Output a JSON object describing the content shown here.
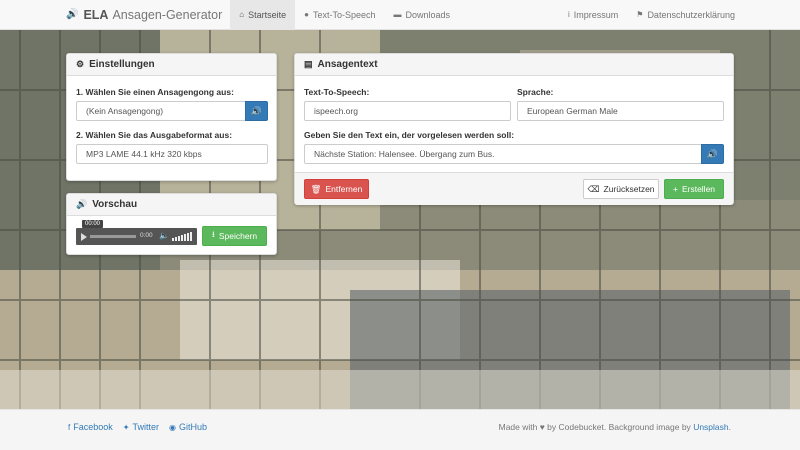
{
  "app": {
    "brand_bold": "ELA",
    "brand_rest": "Ansagen-Generator",
    "brand_icon": "speaker-icon"
  },
  "nav": {
    "left": [
      {
        "label": "Startseite",
        "icon": "home-icon",
        "active": true
      },
      {
        "label": "Text-To-Speech",
        "icon": "comment-icon",
        "active": false
      },
      {
        "label": "Downloads",
        "icon": "folder-icon",
        "active": false
      }
    ],
    "right": [
      {
        "label": "Impressum",
        "icon": "info-icon"
      },
      {
        "label": "Datenschutzerklärung",
        "icon": "flag-icon"
      }
    ]
  },
  "settings": {
    "title": "Einstellungen",
    "q1_label": "1. Wählen Sie einen Ansagengong aus:",
    "q1_value": "(Kein Ansagengong)",
    "q2_label": "2. Wählen Sie das Ausgabeformat aus:",
    "q2_value": "MP3 LAME 44.1 kHz 320 kbps"
  },
  "preview": {
    "title": "Vorschau",
    "time_tooltip": "00:00",
    "time": "0:00",
    "save_label": "Speichern"
  },
  "announcement": {
    "title": "Ansagentext",
    "tts_label": "Text-To-Speech:",
    "tts_value": "ispeech.org",
    "lang_label": "Sprache:",
    "lang_value": "European German Male",
    "text_label": "Geben Sie den Text ein, der vorgelesen werden soll:",
    "text_value": "Nächste Station: Halensee. Übergang zum Bus.",
    "remove_label": "Entfernen",
    "reset_label": "Zurücksetzen",
    "create_label": "Erstellen"
  },
  "footer": {
    "links": [
      "Facebook",
      "Twitter",
      "GitHub"
    ],
    "made_with": "Made with",
    "by": "by Codebucket. Background image by",
    "unsplash": "Unsplash",
    "period": "."
  },
  "colors": {
    "primary": "#337ab7",
    "danger": "#d9534f",
    "success": "#5cb85c",
    "navbar": "#f8f8f8"
  }
}
